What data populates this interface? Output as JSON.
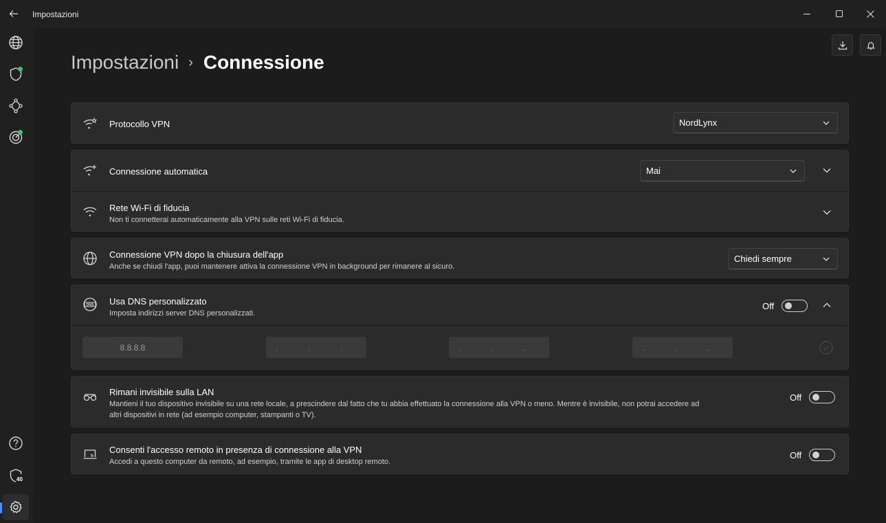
{
  "window": {
    "title": "Impostazioni"
  },
  "breadcrumb": {
    "parent": "Impostazioni",
    "separator": "›",
    "current": "Connessione"
  },
  "sidebar": {
    "top_items": [
      {
        "name": "globe-icon"
      },
      {
        "name": "shield-icon",
        "status_dot": "#3fbf6e"
      },
      {
        "name": "meshnet-icon"
      },
      {
        "name": "target-icon",
        "status_dot": "#3fbf6e"
      }
    ],
    "bottom_items": [
      {
        "name": "help-icon"
      },
      {
        "name": "shield-score-icon",
        "badge": "40"
      },
      {
        "name": "gear-icon",
        "active": true
      }
    ]
  },
  "settings": {
    "vpn_protocol": {
      "title": "Protocollo VPN",
      "value": "NordLynx"
    },
    "auto_connect": {
      "title": "Connessione automatica",
      "value": "Mai"
    },
    "trusted_wifi": {
      "title": "Rete Wi-Fi di fiducia",
      "description": "Non ti connetterai automaticamente alla VPN sulle reti Wi-Fi di fiducia."
    },
    "after_close": {
      "title": "Connessione VPN dopo la chiusura dell'app",
      "description": "Anche se chiudi l'app, puoi mantenere attiva la connessione VPN in background per rimanere al sicuro.",
      "value": "Chiedi sempre"
    },
    "custom_dns": {
      "title": "Usa DNS personalizzato",
      "description": "Imposta indirizzi server DNS personalizzati.",
      "state": "Off",
      "fields": [
        "8.8.8.8",
        ". . .",
        ". . .",
        ". . ."
      ]
    },
    "lan_invisible": {
      "title": "Rimani invisibile sulla LAN",
      "description_line1": "Mantieni il tuo dispositivo invisibile su una rete locale, a prescindere dal fatto che tu abbia effettuato la connessione alla VPN o meno. Mentre è invisibile, non potrai accedere ad",
      "description_line2": "altri dispositivi in rete (ad esempio computer, stampanti o TV).",
      "state": "Off"
    },
    "remote_access": {
      "title": "Consenti l'accesso remoto in presenza di connessione alla VPN",
      "description": "Accedi a questo computer da remoto, ad esempio, tramite le app di desktop remoto.",
      "state": "Off"
    }
  },
  "colors": {
    "background": "#1c1c1c",
    "card": "#2b2b2b",
    "accent": "#4c8dff",
    "status_green": "#3fbf6e"
  }
}
